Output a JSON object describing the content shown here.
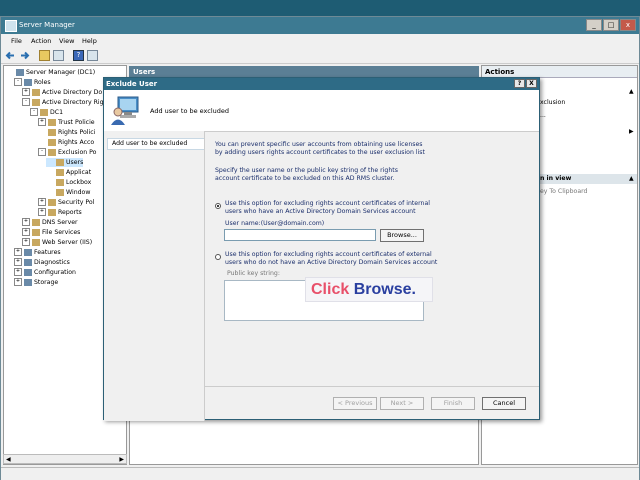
{
  "window": {
    "title": "Server Manager"
  },
  "menu": [
    "File",
    "Action",
    "View",
    "Help"
  ],
  "tree": {
    "items": [
      {
        "label": "Server Manager (DC1)",
        "indent": 0,
        "exp": ""
      },
      {
        "label": "Roles",
        "indent": 1,
        "exp": "-"
      },
      {
        "label": "Active Directory Do",
        "indent": 2,
        "exp": "+"
      },
      {
        "label": "Active Directory Rig",
        "indent": 2,
        "exp": "-"
      },
      {
        "label": "DC1",
        "indent": 3,
        "exp": "-"
      },
      {
        "label": "Trust Policie",
        "indent": 4,
        "exp": "+"
      },
      {
        "label": "Rights Polici",
        "indent": 4,
        "exp": ""
      },
      {
        "label": "Rights Acco",
        "indent": 4,
        "exp": ""
      },
      {
        "label": "Exclusion Po",
        "indent": 4,
        "exp": "-"
      },
      {
        "label": "Users",
        "indent": 5,
        "exp": "",
        "selected": true
      },
      {
        "label": "Applicat",
        "indent": 5,
        "exp": ""
      },
      {
        "label": "Lockbox",
        "indent": 5,
        "exp": ""
      },
      {
        "label": "Window",
        "indent": 5,
        "exp": ""
      },
      {
        "label": "Security Pol",
        "indent": 4,
        "exp": "+"
      },
      {
        "label": "Reports",
        "indent": 4,
        "exp": "+"
      },
      {
        "label": "DNS Server",
        "indent": 2,
        "exp": "+"
      },
      {
        "label": "File Services",
        "indent": 2,
        "exp": "+"
      },
      {
        "label": "Web Server (IIS)",
        "indent": 2,
        "exp": "+"
      },
      {
        "label": "Features",
        "indent": 1,
        "exp": "+"
      },
      {
        "label": "Diagnostics",
        "indent": 1,
        "exp": "+"
      },
      {
        "label": "Configuration",
        "indent": 1,
        "exp": "+"
      },
      {
        "label": "Storage",
        "indent": 1,
        "exp": "+"
      }
    ]
  },
  "center": {
    "header": "Users"
  },
  "actions": {
    "header": "Actions",
    "item1": "xclusion",
    "item2": "...",
    "section2": "n in view",
    "item3": "ey To Clipboard"
  },
  "dialog": {
    "title": "Exclude User",
    "subtitle": "Add user to be excluded",
    "nav_item": "Add user to be excluded",
    "intro": "You can prevent specific user accounts from obtaining use licenses by adding users rights account certificates to the user exclusion list",
    "instruction": "Specify the user name or the public key string of the rights account certificate to be excluded on this AD RMS cluster.",
    "option1": "Use this option for excluding rights account certificates of internal users who have an Active Directory Domain Services account",
    "username_label": "User name:(User@domain.com)",
    "username_value": "",
    "browse": "Browse...",
    "option2": "Use this option for excluding rights account certificates of external users who do not have an Active Directory Domain Services account",
    "pubkey_label": "Public key string:",
    "prev": "< Previous",
    "next": "Next >",
    "finish": "Finish",
    "cancel": "Cancel",
    "help": "?",
    "close": "X"
  },
  "callout": {
    "word1": "Click",
    "word2": "Browse",
    "dot": ".",
    "color1": "#e8506a",
    "color2": "#2a3fa0"
  }
}
